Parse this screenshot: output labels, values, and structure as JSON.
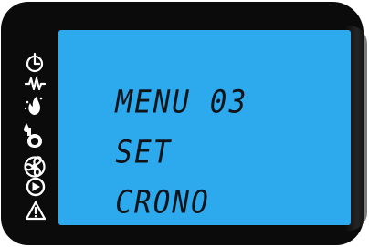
{
  "display": {
    "lines": [
      "MENU 03",
      "SET",
      "CRONO"
    ],
    "background_color": "#2da9ed",
    "bezel_color": "#0b0b0b",
    "text_color": "#101418"
  },
  "status_icons": [
    {
      "name": "timer-icon"
    },
    {
      "name": "resistance-icon"
    },
    {
      "name": "flame-icon"
    },
    {
      "name": "water-icon"
    },
    {
      "name": "fan-icon"
    },
    {
      "name": "play-icon"
    },
    {
      "name": "warning-icon"
    }
  ]
}
